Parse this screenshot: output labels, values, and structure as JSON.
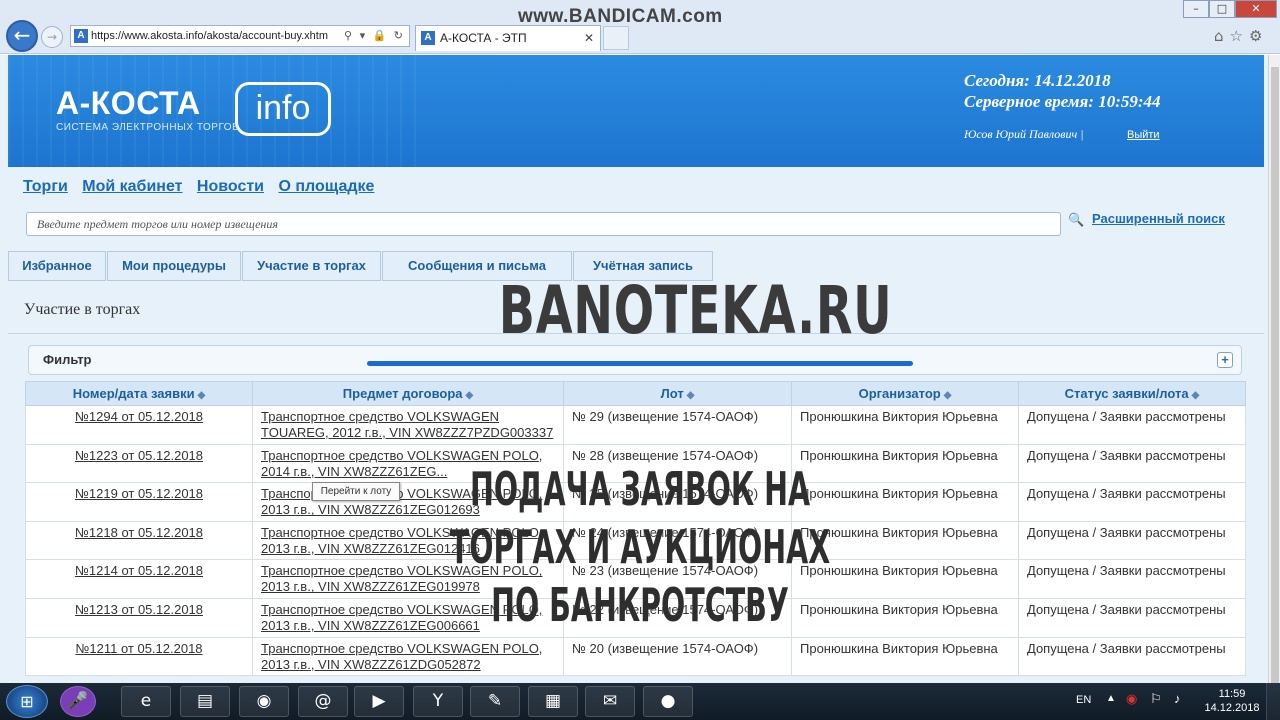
{
  "watermark": "www.BANDICAM.com",
  "browser": {
    "url": "https://www.akosta.info/akosta/account-buy.xhtm",
    "tab_title": "А-КОСТА - ЭТП",
    "back_icon": "back-arrow-icon",
    "favicon_letter": "А"
  },
  "header": {
    "logo_main": "А-КОСТА",
    "logo_box": "info",
    "logo_subtitle": "СИСТЕМА ЭЛЕКТРОННЫХ ТОРГОВ",
    "date_label": "Сегодня: 14.12.2018",
    "time_label": "Серверное время:  10:59:44",
    "user_name": "Юсов Юрий Павлович",
    "logout": "Выйти"
  },
  "nav": {
    "items": [
      "Торги",
      "Мой кабинет",
      "Новости",
      "О площадке"
    ]
  },
  "search": {
    "placeholder": "Введите предмет торгов или номер извещения",
    "advanced": "Расширенный поиск"
  },
  "tabs": [
    {
      "label": "Избранное"
    },
    {
      "label": "Мои процедуры"
    },
    {
      "label": "Участие в торгах"
    },
    {
      "label": "Сообщения и письма"
    },
    {
      "label": "Учётная запись"
    }
  ],
  "page_title": "Участие в торгах",
  "filter": {
    "label": "Фильтр",
    "plus": "+"
  },
  "table": {
    "headers": [
      "Номер/дата заявки",
      "Предмет договора",
      "Лот",
      "Организатор",
      "Статус заявки/лота"
    ],
    "rows": [
      {
        "num": "№1294 от 05.12.2018",
        "subject": "Транспортное средство VOLKSWAGEN TOUAREG, 2012 г.в., VIN XW8ZZZ7PZDG003337",
        "lot": "№ 29 (извещение 1574-ОАОФ)",
        "org": "Пронюшкина Виктория Юрьевна",
        "status": "Допущена / Заявки рассмотрены"
      },
      {
        "num": "№1223 от 05.12.2018",
        "subject": "Транспортное средство VOLKSWAGEN POLO, 2014 г.в., VIN XW8ZZZ61ZEG...",
        "lot": "№ 28 (извещение 1574-ОАОФ)",
        "org": "Пронюшкина Виктория Юрьевна",
        "status": "Допущена / Заявки рассмотрены"
      },
      {
        "num": "№1219 от 05.12.2018",
        "subject": "Транспортное средство VOLKSWAGEN POLO, 2013 г.в., VIN XW8ZZZ61ZEG012693",
        "lot": "№ 25 (извещение 1574-ОАОФ)",
        "org": "Пронюшкина Виктория Юрьевна",
        "status": "Допущена / Заявки рассмотрены"
      },
      {
        "num": "№1218 от 05.12.2018",
        "subject": "Транспортное средство VOLKSWAGEN POLO, 2013 г.в., VIN XW8ZZZ61ZEG012416",
        "lot": "№ 24 (извещение 1574-ОАОФ)",
        "org": "Пронюшкина Виктория Юрьевна",
        "status": "Допущена / Заявки рассмотрены"
      },
      {
        "num": "№1214 от 05.12.2018",
        "subject": "Транспортное средство VOLKSWAGEN POLO, 2013 г.в., VIN XW8ZZZ61ZEG019978",
        "lot": "№ 23 (извещение 1574-ОАОФ)",
        "org": "Пронюшкина Виктория Юрьевна",
        "status": "Допущена / Заявки рассмотрены"
      },
      {
        "num": "№1213 от 05.12.2018",
        "subject": "Транспортное средство VOLKSWAGEN POLO, 2013 г.в., VIN XW8ZZZ61ZEG006661",
        "lot": "№ 22 (извещение 1574-ОАОФ)",
        "org": "Пронюшкина Виктория Юрьевна",
        "status": "Допущена / Заявки рассмотрены"
      },
      {
        "num": "№1211 от 05.12.2018",
        "subject": "Транспортное средство VOLKSWAGEN POLO, 2013 г.в., VIN XW8ZZZ61ZDG052872",
        "lot": "№ 20 (извещение 1574-ОАОФ)",
        "org": "Пронюшкина Виктория Юрьевна",
        "status": "Допущена / Заявки рассмотрены"
      }
    ]
  },
  "tooltip": "Перейти к лоту",
  "overlay": {
    "title": "BANOTEKA.RU",
    "caption": "ПОДАЧА ЗАЯВОК НА ТОРГАХ И АУКЦИОНАХ ПО БАНКРОТСТВУ"
  },
  "taskbar": {
    "lang": "EN",
    "time": "11:59",
    "date": "14.12.2018"
  }
}
